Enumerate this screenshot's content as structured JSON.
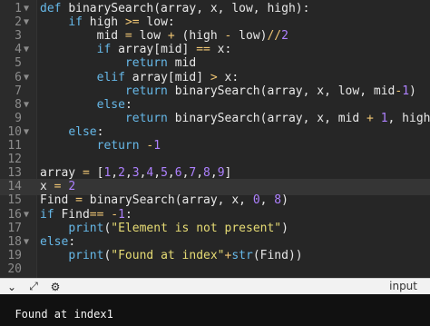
{
  "editor": {
    "current_line": 14,
    "lines": [
      {
        "n": "1",
        "fold": "▼",
        "tokens": [
          {
            "t": "def ",
            "c": "kw"
          },
          {
            "t": "binarySearch(array, x, low, high):",
            "c": "fn"
          }
        ]
      },
      {
        "n": "2",
        "fold": "▼",
        "tokens": [
          {
            "t": "    "
          },
          {
            "t": "if ",
            "c": "kw"
          },
          {
            "t": "high "
          },
          {
            "t": ">=",
            "c": "op"
          },
          {
            "t": " low:"
          }
        ]
      },
      {
        "n": "3",
        "tokens": [
          {
            "t": "        mid "
          },
          {
            "t": "=",
            "c": "op"
          },
          {
            "t": " low "
          },
          {
            "t": "+",
            "c": "op"
          },
          {
            "t": " (high "
          },
          {
            "t": "-",
            "c": "op"
          },
          {
            "t": " low)"
          },
          {
            "t": "//",
            "c": "op"
          },
          {
            "t": "2",
            "c": "num"
          }
        ]
      },
      {
        "n": "4",
        "fold": "▼",
        "tokens": [
          {
            "t": "        "
          },
          {
            "t": "if ",
            "c": "kw"
          },
          {
            "t": "array[mid] "
          },
          {
            "t": "==",
            "c": "op"
          },
          {
            "t": " x:"
          }
        ]
      },
      {
        "n": "5",
        "tokens": [
          {
            "t": "            "
          },
          {
            "t": "return ",
            "c": "kw"
          },
          {
            "t": "mid"
          }
        ]
      },
      {
        "n": "6",
        "fold": "▼",
        "tokens": [
          {
            "t": "        "
          },
          {
            "t": "elif ",
            "c": "kw"
          },
          {
            "t": "array[mid] "
          },
          {
            "t": ">",
            "c": "op"
          },
          {
            "t": " x:"
          }
        ]
      },
      {
        "n": "7",
        "tokens": [
          {
            "t": "            "
          },
          {
            "t": "return ",
            "c": "kw"
          },
          {
            "t": "binarySearch(array, x, low, mid"
          },
          {
            "t": "-",
            "c": "op"
          },
          {
            "t": "1",
            "c": "num"
          },
          {
            "t": ")"
          }
        ]
      },
      {
        "n": "8",
        "fold": "▼",
        "tokens": [
          {
            "t": "        "
          },
          {
            "t": "else",
            "c": "kw"
          },
          {
            "t": ":"
          }
        ]
      },
      {
        "n": "9",
        "tokens": [
          {
            "t": "            "
          },
          {
            "t": "return ",
            "c": "kw"
          },
          {
            "t": "binarySearch(array, x, mid "
          },
          {
            "t": "+",
            "c": "op"
          },
          {
            "t": " "
          },
          {
            "t": "1",
            "c": "num"
          },
          {
            "t": ", high)"
          }
        ]
      },
      {
        "n": "10",
        "fold": "▼",
        "tokens": [
          {
            "t": "    "
          },
          {
            "t": "else",
            "c": "kw"
          },
          {
            "t": ":"
          }
        ]
      },
      {
        "n": "11",
        "tokens": [
          {
            "t": "        "
          },
          {
            "t": "return ",
            "c": "kw"
          },
          {
            "t": "-",
            "c": "op"
          },
          {
            "t": "1",
            "c": "num"
          }
        ]
      },
      {
        "n": "12",
        "tokens": []
      },
      {
        "n": "13",
        "tokens": [
          {
            "t": "array "
          },
          {
            "t": "=",
            "c": "op"
          },
          {
            "t": " ["
          },
          {
            "t": "1",
            "c": "num"
          },
          {
            "t": ","
          },
          {
            "t": "2",
            "c": "num"
          },
          {
            "t": ","
          },
          {
            "t": "3",
            "c": "num"
          },
          {
            "t": ","
          },
          {
            "t": "4",
            "c": "num"
          },
          {
            "t": ","
          },
          {
            "t": "5",
            "c": "num"
          },
          {
            "t": ","
          },
          {
            "t": "6",
            "c": "num"
          },
          {
            "t": ","
          },
          {
            "t": "7",
            "c": "num"
          },
          {
            "t": ","
          },
          {
            "t": "8",
            "c": "num"
          },
          {
            "t": ","
          },
          {
            "t": "9",
            "c": "num"
          },
          {
            "t": "]"
          }
        ]
      },
      {
        "n": "14",
        "tokens": [
          {
            "t": "x "
          },
          {
            "t": "=",
            "c": "op"
          },
          {
            "t": " "
          },
          {
            "t": "2",
            "c": "num"
          }
        ]
      },
      {
        "n": "15",
        "tokens": [
          {
            "t": "Find "
          },
          {
            "t": "=",
            "c": "op"
          },
          {
            "t": " binarySearch(array, x, "
          },
          {
            "t": "0",
            "c": "num"
          },
          {
            "t": ", "
          },
          {
            "t": "8",
            "c": "num"
          },
          {
            "t": ")"
          }
        ]
      },
      {
        "n": "16",
        "fold": "▼",
        "tokens": [
          {
            "t": "if ",
            "c": "kw"
          },
          {
            "t": "Find"
          },
          {
            "t": "==",
            "c": "op"
          },
          {
            "t": " "
          },
          {
            "t": "-",
            "c": "op"
          },
          {
            "t": "1",
            "c": "num"
          },
          {
            "t": ":"
          }
        ]
      },
      {
        "n": "17",
        "tokens": [
          {
            "t": "    "
          },
          {
            "t": "print",
            "c": "kw"
          },
          {
            "t": "("
          },
          {
            "t": "\"Element is not present\"",
            "c": "str"
          },
          {
            "t": ")"
          }
        ]
      },
      {
        "n": "18",
        "fold": "▼",
        "tokens": [
          {
            "t": "else",
            "c": "kw"
          },
          {
            "t": ":"
          }
        ]
      },
      {
        "n": "19",
        "tokens": [
          {
            "t": "    "
          },
          {
            "t": "print",
            "c": "kw"
          },
          {
            "t": "("
          },
          {
            "t": "\"Found at index\"",
            "c": "str"
          },
          {
            "t": "+",
            "c": "op"
          },
          {
            "t": "str",
            "c": "kw"
          },
          {
            "t": "(Find))"
          }
        ]
      },
      {
        "n": "20",
        "tokens": []
      }
    ]
  },
  "toolbar": {
    "icons": [
      "chevron-down-icon",
      "expand-icon",
      "stdin-settings-icon"
    ],
    "icon_glyphs": [
      "⌄",
      "⤢",
      "⚙"
    ],
    "input_label": "input"
  },
  "output": {
    "text": "Found at index1"
  }
}
